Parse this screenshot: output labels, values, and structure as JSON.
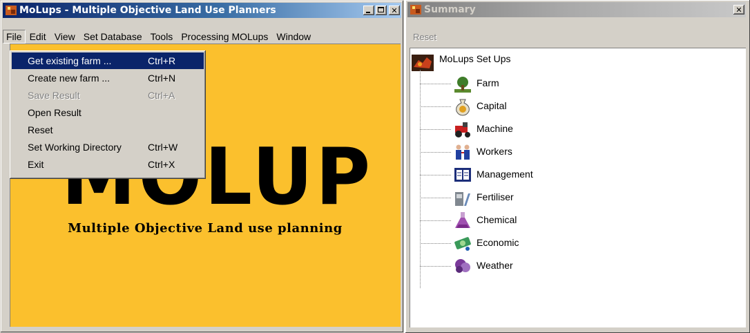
{
  "main_window": {
    "title": "MoLups - Multiple Objective Land Use Planners",
    "controls": {
      "minimize": "_",
      "maximize": "□",
      "close": "✕"
    },
    "menu": [
      "File",
      "Edit",
      "View",
      "Set Database",
      "Tools",
      "Processing MOLups",
      "Window"
    ],
    "file_menu": [
      {
        "label": "Get existing farm ...",
        "shortcut": "Ctrl+R",
        "state": "selected"
      },
      {
        "label": "Create new farm ...",
        "shortcut": "Ctrl+N",
        "state": "enabled"
      },
      {
        "label": "Save Result",
        "shortcut": "Ctrl+A",
        "state": "disabled"
      },
      {
        "label": "Open Result",
        "shortcut": "",
        "state": "enabled"
      },
      {
        "label": "Reset",
        "shortcut": "",
        "state": "enabled"
      },
      {
        "label": "Set Working Directory",
        "shortcut": "Ctrl+W",
        "state": "enabled"
      },
      {
        "label": "Exit",
        "shortcut": "Ctrl+X",
        "state": "enabled"
      }
    ],
    "logo_text": "MOLUP",
    "logo_subtitle": "Multiple Objective Land use planning",
    "background_color": "#fbc02d"
  },
  "summary_window": {
    "title": "Summary",
    "close": "✕",
    "menu_item": "Reset",
    "tree": {
      "root": {
        "label": "MoLups Set Ups",
        "icon": "molups-icon"
      },
      "children": [
        {
          "label": "Farm",
          "icon": "farm-icon"
        },
        {
          "label": "Capital",
          "icon": "capital-icon"
        },
        {
          "label": "Machine",
          "icon": "machine-icon"
        },
        {
          "label": "Workers",
          "icon": "workers-icon"
        },
        {
          "label": "Management",
          "icon": "management-icon"
        },
        {
          "label": "Fertiliser",
          "icon": "fertiliser-icon"
        },
        {
          "label": "Chemical",
          "icon": "chemical-icon"
        },
        {
          "label": "Economic",
          "icon": "economic-icon"
        },
        {
          "label": "Weather",
          "icon": "weather-icon"
        }
      ]
    }
  }
}
